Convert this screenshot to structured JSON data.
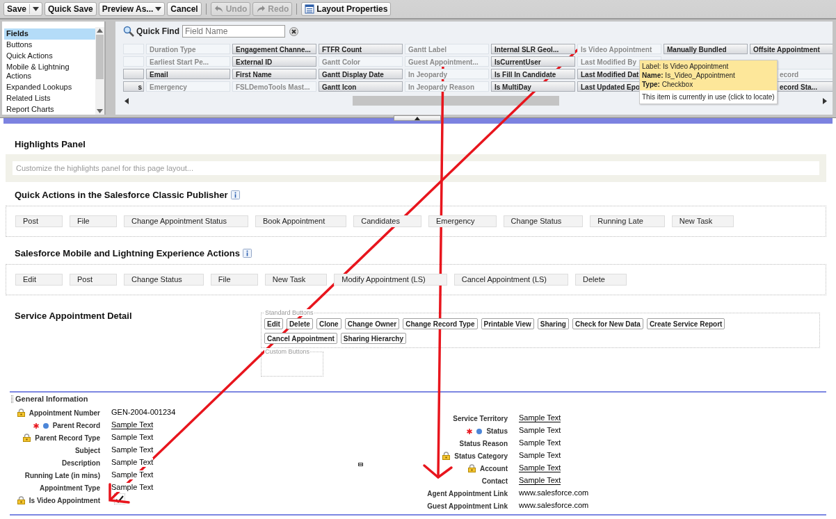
{
  "toolbar": {
    "groups": [
      [
        {
          "kind": "split",
          "label": "Save",
          "disabled": false
        },
        {
          "kind": "plain",
          "label": "Quick Save",
          "disabled": false
        },
        {
          "kind": "dropdown",
          "label": "Preview As...",
          "disabled": false
        },
        {
          "kind": "plain",
          "label": "Cancel",
          "disabled": false
        }
      ],
      [
        {
          "kind": "undo",
          "label": "Undo",
          "disabled": true
        },
        {
          "kind": "redo",
          "label": "Redo",
          "disabled": true
        }
      ],
      [
        {
          "kind": "properties",
          "label": "Layout Properties",
          "disabled": false
        }
      ]
    ]
  },
  "palette": {
    "categories": [
      {
        "label": "Fields",
        "selected": true
      },
      {
        "label": "Buttons",
        "selected": false
      },
      {
        "label": "Quick Actions",
        "selected": false
      },
      {
        "label": "Mobile & Lightning Actions",
        "selected": false
      },
      {
        "label": "Expanded Lookups",
        "selected": false
      },
      {
        "label": "Related Lists",
        "selected": false
      },
      {
        "label": "Report Charts",
        "selected": false
      }
    ],
    "quick_find": {
      "label": "Quick Find",
      "placeholder": "Field Name"
    },
    "rows": [
      [
        {
          "in_use": true
        },
        {
          "text": "Duration Type",
          "in_use": true
        },
        {
          "text": "Engagement Channe...",
          "in_use": false
        },
        {
          "text": "FTFR Count",
          "in_use": false
        },
        {
          "text": "Gantt Label",
          "in_use": true
        },
        {
          "text": "Internal SLR Geol...",
          "in_use": false
        },
        {
          "text": "Is Video Appointment",
          "in_use": true
        },
        {
          "text": "Manually Bundled",
          "in_use": false
        },
        {
          "text": "Offsite Appointment",
          "in_use": false
        }
      ],
      [
        {
          "in_use": true
        },
        {
          "text": "Earliest Start Pe...",
          "in_use": true
        },
        {
          "text": "External ID",
          "in_use": false
        },
        {
          "text": "Gantt Color",
          "in_use": true
        },
        {
          "text": "Guest Appointment...",
          "in_use": true
        },
        {
          "text": "IsCurrentUser",
          "in_use": false
        },
        {
          "text": "Last Modified By",
          "in_use": true
        },
        null,
        null
      ],
      [
        {
          "in_use": false
        },
        {
          "text": "Email",
          "in_use": false
        },
        {
          "text": "First Name",
          "in_use": false
        },
        {
          "text": "Gantt Display Date",
          "in_use": false
        },
        {
          "text": "In Jeopardy",
          "in_use": true
        },
        {
          "text": "Is Fill In Candidate",
          "in_use": false
        },
        {
          "text": "Last Modified Dat",
          "in_use": false
        },
        null,
        {
          "text": "ecord",
          "in_use": true,
          "cut_start": true
        }
      ],
      [
        {
          "text": "s",
          "in_use": false
        },
        {
          "text": "Emergency",
          "in_use": true
        },
        {
          "text": "FSLDemoTools Mast...",
          "in_use": true
        },
        {
          "text": "Gantt Icon",
          "in_use": false
        },
        {
          "text": "In Jeopardy Reason",
          "in_use": true
        },
        {
          "text": "Is MultiDay",
          "in_use": false
        },
        {
          "text": "Last Updated Epo",
          "in_use": false
        },
        null,
        {
          "text": "ecord Sta...",
          "in_use": false,
          "cut_start": true
        }
      ]
    ],
    "tooltip": {
      "lines": [
        "Label: Is Video Appointment",
        "**Name:** Is_Video_Appointment",
        "**Type:** Checkbox"
      ],
      "note": "This item is currently in use (click to locate)"
    }
  },
  "highlights": {
    "title": "Highlights Panel",
    "placeholder": "Customize the highlights panel for this page layout..."
  },
  "quick_actions": {
    "title": "Quick Actions in the Salesforce Classic Publisher",
    "actions": [
      "Post",
      "File",
      "Change Appointment Status",
      "Book Appointment",
      "Candidates",
      "Emergency",
      "Change Status",
      "Running Late",
      "New Task"
    ]
  },
  "mobile_actions": {
    "title": "Salesforce Mobile and Lightning Experience Actions",
    "actions": [
      "Edit",
      "Post",
      "Change Status",
      "File",
      "New Task",
      "Modify Appointment (LS)",
      "Cancel Appointment (LS)",
      "Delete"
    ]
  },
  "detail": {
    "title": "Service Appointment Detail",
    "standard_buttons": {
      "legend": "Standard Buttons",
      "buttons": [
        "Edit",
        "Delete",
        "Clone",
        "Change Owner",
        "Change Record Type",
        "Printable View",
        "Sharing",
        "Check for New Data",
        "Create Service Report",
        "Cancel Appointment",
        "Sharing Hierarchy"
      ]
    },
    "custom_buttons": {
      "legend": "Custom Buttons"
    }
  },
  "section": {
    "title": "General Information",
    "left": [
      {
        "kind": "text",
        "label": "Appointment Number",
        "value": "GEN-2004-001234",
        "locked": true,
        "required": false,
        "dot": false,
        "link": false
      },
      {
        "kind": "text",
        "label": "Parent Record",
        "value": "Sample Text",
        "locked": false,
        "required": true,
        "dot": true,
        "link": true
      },
      {
        "kind": "text",
        "label": "Parent Record Type",
        "value": "Sample Text",
        "locked": true,
        "required": false,
        "dot": false,
        "link": false
      },
      {
        "kind": "text",
        "label": "Subject",
        "value": "Sample Text",
        "locked": false,
        "required": false,
        "dot": false,
        "link": false
      },
      {
        "kind": "text",
        "label": "Description",
        "value": "Sample Text",
        "locked": false,
        "required": false,
        "dot": false,
        "link": false
      },
      {
        "kind": "text",
        "label": "Running Late (in mins)",
        "value": "Sample Text",
        "locked": false,
        "required": false,
        "dot": false,
        "link": false
      },
      {
        "kind": "text",
        "label": "Appointment Type",
        "value": "Sample Text",
        "locked": false,
        "required": false,
        "dot": false,
        "link": false
      },
      {
        "kind": "checkbox",
        "label": "Is Video Appointment",
        "checked": true,
        "locked": true,
        "required": false,
        "dot": false
      }
    ],
    "right": [
      {
        "kind": "text",
        "label": "Service Territory",
        "value": "Sample Text",
        "locked": false,
        "required": false,
        "dot": false,
        "link": true
      },
      {
        "kind": "text",
        "label": "Status",
        "value": "Sample Text",
        "locked": false,
        "required": true,
        "dot": true,
        "link": false
      },
      {
        "kind": "text",
        "label": "Status Reason",
        "value": "Sample Text",
        "locked": false,
        "required": false,
        "dot": false,
        "link": false
      },
      {
        "kind": "text",
        "label": "Status Category",
        "value": "Sample Text",
        "locked": true,
        "required": false,
        "dot": false,
        "link": false
      },
      {
        "kind": "text",
        "label": "Account",
        "value": "Sample Text",
        "locked": true,
        "required": false,
        "dot": false,
        "link": true
      },
      {
        "kind": "text",
        "label": "Contact",
        "value": "Sample Text",
        "locked": false,
        "required": false,
        "dot": false,
        "link": true
      },
      {
        "kind": "text",
        "label": "Agent Appointment Link",
        "value": "www.salesforce.com",
        "locked": false,
        "required": false,
        "dot": false,
        "link": false
      },
      {
        "kind": "text",
        "label": "Guest Appointment Link",
        "value": "www.salesforce.com",
        "locked": false,
        "required": false,
        "dot": false,
        "link": false
      }
    ]
  }
}
